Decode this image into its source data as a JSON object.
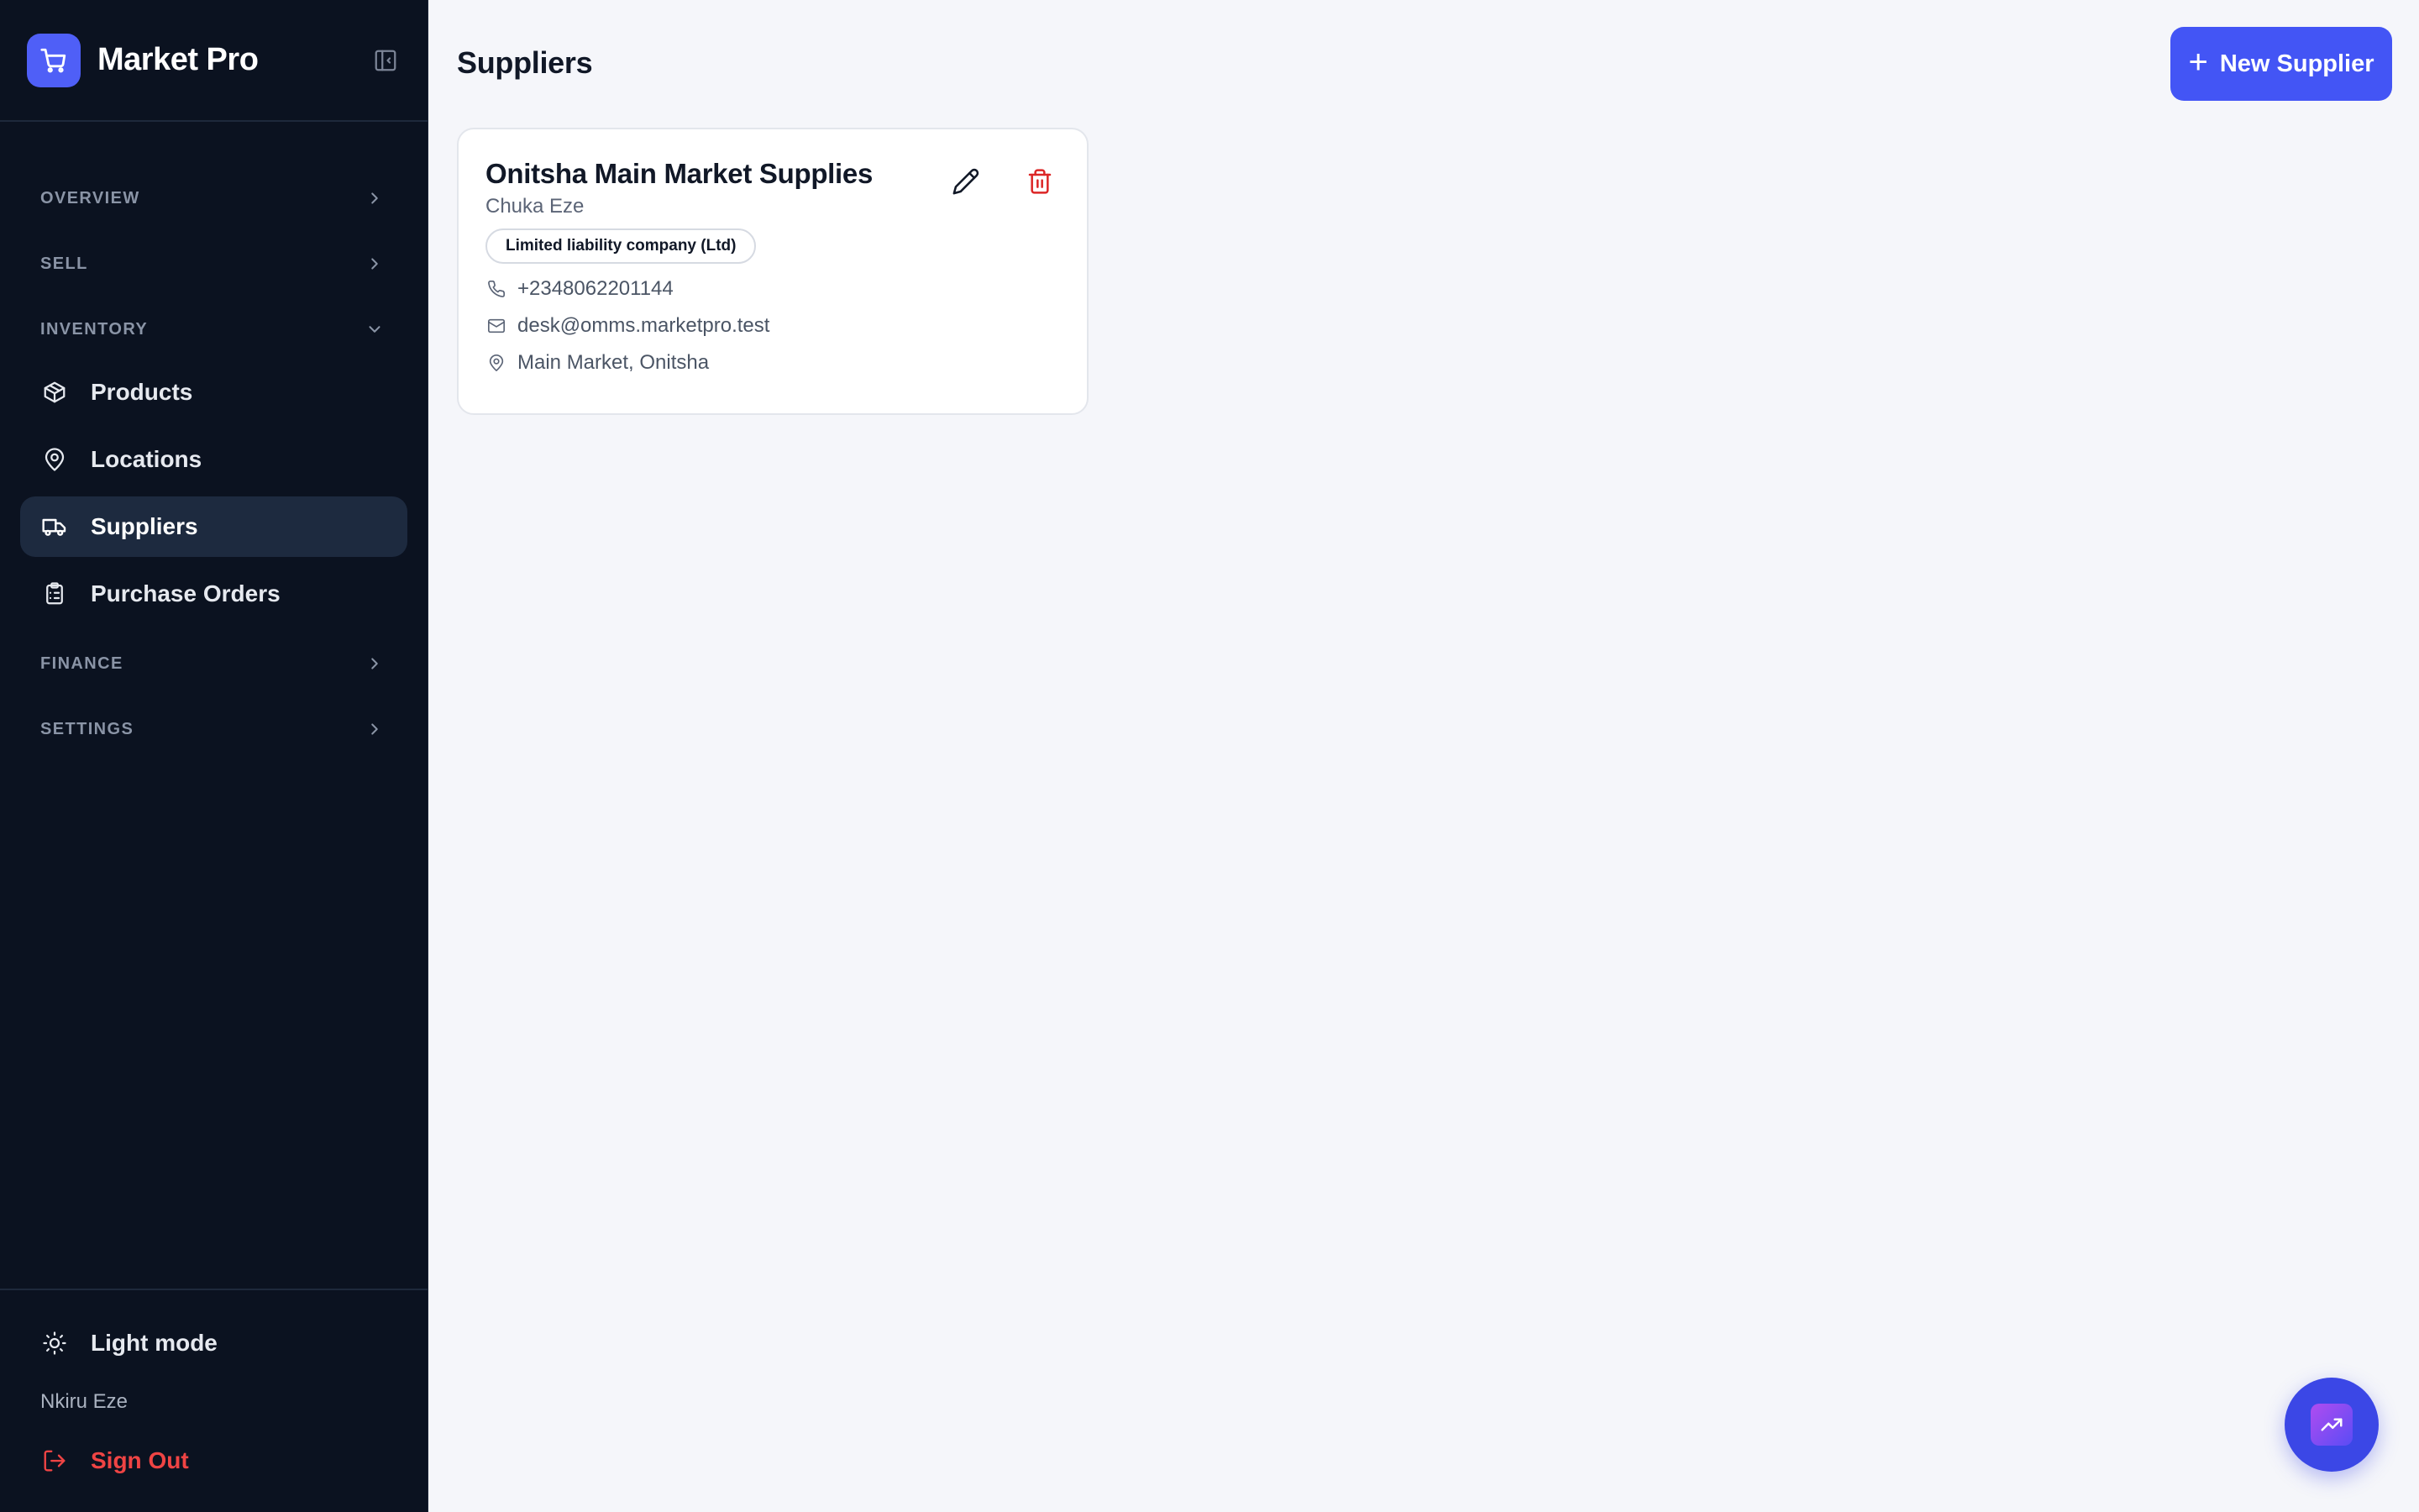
{
  "app": {
    "name": "Market Pro",
    "accent_color": "#4355f5"
  },
  "sidebar": {
    "sections": [
      {
        "label": "OVERVIEW",
        "expanded": false
      },
      {
        "label": "SELL",
        "expanded": false
      },
      {
        "label": "INVENTORY",
        "expanded": true,
        "items": [
          {
            "label": "Products",
            "icon": "package-icon",
            "active": false
          },
          {
            "label": "Locations",
            "icon": "map-pin-icon",
            "active": false
          },
          {
            "label": "Suppliers",
            "icon": "truck-icon",
            "active": true
          },
          {
            "label": "Purchase Orders",
            "icon": "clipboard-list-icon",
            "active": false
          }
        ]
      },
      {
        "label": "FINANCE",
        "expanded": false
      },
      {
        "label": "SETTINGS",
        "expanded": false
      }
    ],
    "footer": {
      "theme_toggle_label": "Light mode",
      "user_name": "Nkiru Eze",
      "sign_out_label": "Sign Out"
    }
  },
  "main": {
    "title": "Suppliers",
    "new_button_label": "New Supplier",
    "suppliers": [
      {
        "name": "Onitsha Main Market Supplies",
        "contact": "Chuka Eze",
        "type": "Limited liability company (Ltd)",
        "phone": "+2348062201144",
        "email": "desk@omms.marketpro.test",
        "address": "Main Market, Onitsha"
      }
    ]
  }
}
